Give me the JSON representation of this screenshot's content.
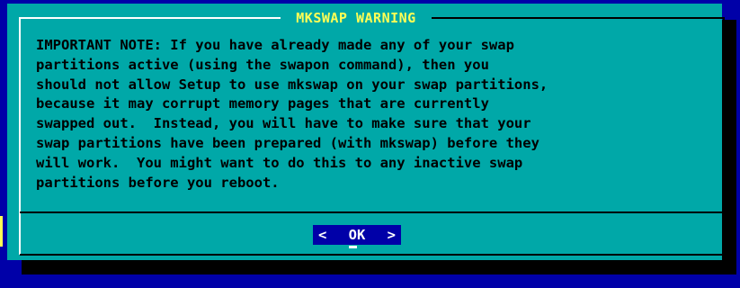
{
  "dialog": {
    "title": "MKSWAP WARNING",
    "message": "IMPORTANT NOTE: If you have already made any of your swap\npartitions active (using the swapon command), then you\nshould not allow Setup to use mkswap on your swap partitions,\nbecause it may corrupt memory pages that are currently\nswapped out.  Instead, you will have to make sure that your\nswap partitions have been prepared (with mkswap) before they\nwill work.  You might want to do this to any inactive swap\npartitions before you reboot.",
    "ok_button": {
      "left_bracket": "<",
      "label": "OK",
      "right_bracket": ">"
    }
  },
  "colors": {
    "background": "#0000a8",
    "dialog": "#00a8a8",
    "title": "#ffff55",
    "text": "#000000",
    "button_bg": "#0000a8",
    "button_text": "#ffffff",
    "shadow": "#000000"
  }
}
